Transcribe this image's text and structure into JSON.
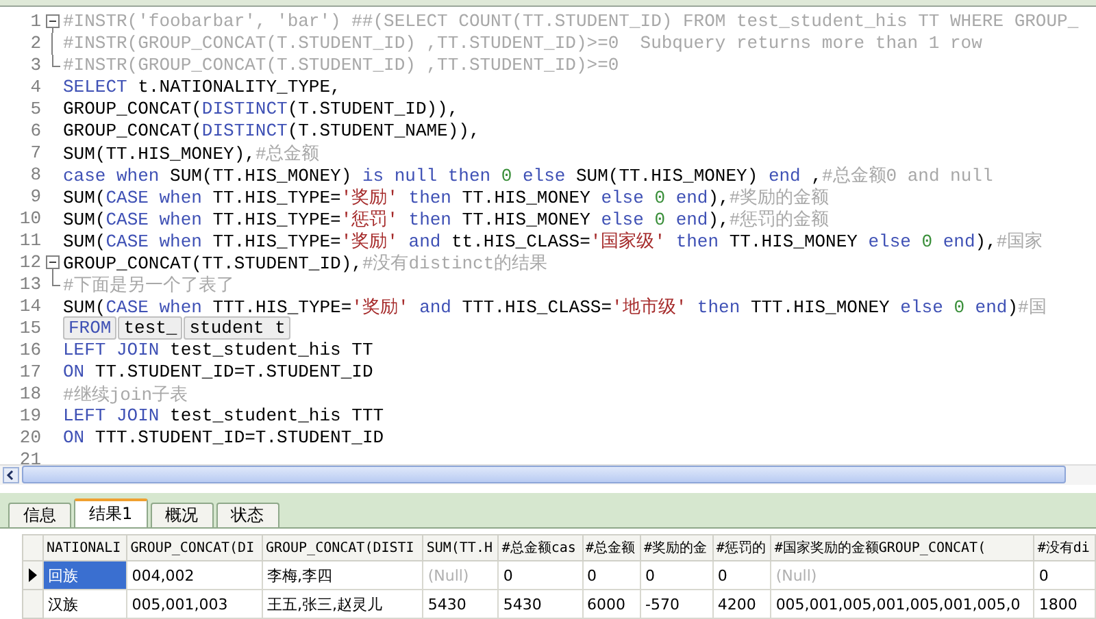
{
  "editor": {
    "lines": [
      {
        "number": "1",
        "kind": "fold-start",
        "tokens": [
          {
            "kind": "comment",
            "text": "#INSTR('foobarbar', 'bar') ##(SELECT COUNT(TT.STUDENT_ID) FROM test_student_his TT WHERE GROUP_"
          }
        ]
      },
      {
        "number": "2",
        "kind": "fold-line",
        "tokens": [
          {
            "kind": "comment",
            "text": "#INSTR(GROUP_CONCAT(T.STUDENT_ID) ,TT.STUDENT_ID)>=0  Subquery returns more than 1 row"
          }
        ]
      },
      {
        "number": "3",
        "kind": "fold-end",
        "tokens": [
          {
            "kind": "comment",
            "text": "#INSTR(GROUP_CONCAT(T.STUDENT_ID) ,TT.STUDENT_ID)>=0"
          }
        ]
      },
      {
        "number": "4",
        "kind": "code",
        "tokens": [
          {
            "kind": "keyword",
            "text": "SELECT"
          },
          {
            "kind": "plain",
            "text": " t.NATIONALITY_TYPE,"
          }
        ]
      },
      {
        "number": "5",
        "kind": "code",
        "tokens": [
          {
            "kind": "plain",
            "text": "GROUP_CONCAT("
          },
          {
            "kind": "keyword",
            "text": "DISTINCT"
          },
          {
            "kind": "plain",
            "text": "(T.STUDENT_ID)),"
          }
        ]
      },
      {
        "number": "6",
        "kind": "code",
        "tokens": [
          {
            "kind": "plain",
            "text": "GROUP_CONCAT("
          },
          {
            "kind": "keyword",
            "text": "DISTINCT"
          },
          {
            "kind": "plain",
            "text": "(T.STUDENT_NAME)),"
          }
        ]
      },
      {
        "number": "7",
        "kind": "code",
        "tokens": [
          {
            "kind": "plain",
            "text": "SUM(TT.HIS_MONEY),"
          },
          {
            "kind": "comment",
            "text": "#总金额"
          }
        ]
      },
      {
        "number": "8",
        "kind": "code",
        "tokens": [
          {
            "kind": "keyword",
            "text": "case when"
          },
          {
            "kind": "plain",
            "text": " SUM(TT.HIS_MONEY) "
          },
          {
            "kind": "keyword",
            "text": "is null then"
          },
          {
            "kind": "number",
            "text": " 0"
          },
          {
            "kind": "keyword",
            "text": " else"
          },
          {
            "kind": "plain",
            "text": " SUM(TT.HIS_MONEY) "
          },
          {
            "kind": "keyword",
            "text": "end"
          },
          {
            "kind": "plain",
            "text": " ,"
          },
          {
            "kind": "comment",
            "text": "#总金额0 and null"
          }
        ]
      },
      {
        "number": "9",
        "kind": "code",
        "tokens": [
          {
            "kind": "plain",
            "text": "SUM("
          },
          {
            "kind": "keyword",
            "text": "CASE when"
          },
          {
            "kind": "plain",
            "text": " TT.HIS_TYPE="
          },
          {
            "kind": "string",
            "text": "'奖励'"
          },
          {
            "kind": "keyword",
            "text": " then"
          },
          {
            "kind": "plain",
            "text": " TT.HIS_MONEY "
          },
          {
            "kind": "keyword",
            "text": "else"
          },
          {
            "kind": "number",
            "text": " 0"
          },
          {
            "kind": "keyword",
            "text": " end"
          },
          {
            "kind": "plain",
            "text": "),"
          },
          {
            "kind": "comment",
            "text": "#奖励的金额"
          }
        ]
      },
      {
        "number": "10",
        "kind": "code",
        "tokens": [
          {
            "kind": "plain",
            "text": "SUM("
          },
          {
            "kind": "keyword",
            "text": "CASE when"
          },
          {
            "kind": "plain",
            "text": " TT.HIS_TYPE="
          },
          {
            "kind": "string",
            "text": "'惩罚'"
          },
          {
            "kind": "keyword",
            "text": " then"
          },
          {
            "kind": "plain",
            "text": " TT.HIS_MONEY "
          },
          {
            "kind": "keyword",
            "text": "else"
          },
          {
            "kind": "number",
            "text": " 0"
          },
          {
            "kind": "keyword",
            "text": " end"
          },
          {
            "kind": "plain",
            "text": "),"
          },
          {
            "kind": "comment",
            "text": "#惩罚的金额"
          }
        ]
      },
      {
        "number": "11",
        "kind": "code",
        "tokens": [
          {
            "kind": "plain",
            "text": "SUM("
          },
          {
            "kind": "keyword",
            "text": "CASE when"
          },
          {
            "kind": "plain",
            "text": " TT.HIS_TYPE="
          },
          {
            "kind": "string",
            "text": "'奖励'"
          },
          {
            "kind": "keyword",
            "text": " and"
          },
          {
            "kind": "plain",
            "text": " tt.HIS_CLASS="
          },
          {
            "kind": "string",
            "text": "'国家级'"
          },
          {
            "kind": "keyword",
            "text": " then"
          },
          {
            "kind": "plain",
            "text": " TT.HIS_MONEY "
          },
          {
            "kind": "keyword",
            "text": "else"
          },
          {
            "kind": "number",
            "text": " 0"
          },
          {
            "kind": "keyword",
            "text": " end"
          },
          {
            "kind": "plain",
            "text": "),"
          },
          {
            "kind": "comment",
            "text": "#国家"
          }
        ]
      },
      {
        "number": "12",
        "kind": "fold-start",
        "tokens": [
          {
            "kind": "plain",
            "text": "GROUP_CONCAT(TT.STUDENT_ID),"
          },
          {
            "kind": "comment",
            "text": "#没有distinct的结果"
          }
        ]
      },
      {
        "number": "13",
        "kind": "fold-end",
        "tokens": [
          {
            "kind": "comment",
            "text": "#下面是另一个了表了"
          }
        ]
      },
      {
        "number": "14",
        "kind": "code",
        "tokens": [
          {
            "kind": "plain",
            "text": "SUM("
          },
          {
            "kind": "keyword",
            "text": "CASE when"
          },
          {
            "kind": "plain",
            "text": " TTT.HIS_TYPE="
          },
          {
            "kind": "string",
            "text": "'奖励'"
          },
          {
            "kind": "keyword",
            "text": " and"
          },
          {
            "kind": "plain",
            "text": " TTT.HIS_CLASS="
          },
          {
            "kind": "string",
            "text": "'地市级'"
          },
          {
            "kind": "keyword",
            "text": " then"
          },
          {
            "kind": "plain",
            "text": " TTT.HIS_MONEY "
          },
          {
            "kind": "keyword",
            "text": "else"
          },
          {
            "kind": "number",
            "text": " 0"
          },
          {
            "kind": "keyword",
            "text": " end"
          },
          {
            "kind": "plain",
            "text": ")"
          },
          {
            "kind": "comment",
            "text": "#国"
          }
        ]
      },
      {
        "number": "15",
        "kind": "code",
        "tokens": [
          {
            "kind": "boxed-keyword",
            "text": "FROM"
          },
          {
            "kind": "boxed",
            "text": "test_"
          },
          {
            "kind": "boxed",
            "text": "student t"
          }
        ]
      },
      {
        "number": "16",
        "kind": "code",
        "tokens": [
          {
            "kind": "keyword",
            "text": "LEFT JOIN"
          },
          {
            "kind": "plain",
            "text": " test_student_his TT"
          }
        ]
      },
      {
        "number": "17",
        "kind": "code",
        "tokens": [
          {
            "kind": "keyword",
            "text": "ON"
          },
          {
            "kind": "plain",
            "text": " TT.STUDENT_ID=T.STUDENT_ID"
          }
        ]
      },
      {
        "number": "18",
        "kind": "code",
        "tokens": [
          {
            "kind": "comment",
            "text": "#继续join子表"
          }
        ]
      },
      {
        "number": "19",
        "kind": "code",
        "tokens": [
          {
            "kind": "keyword",
            "text": "LEFT JOIN"
          },
          {
            "kind": "plain",
            "text": " test_student_his TTT"
          }
        ]
      },
      {
        "number": "20",
        "kind": "code",
        "tokens": [
          {
            "kind": "keyword",
            "text": "ON"
          },
          {
            "kind": "plain",
            "text": " TTT.STUDENT_ID=T.STUDENT_ID"
          }
        ]
      },
      {
        "number": "21",
        "kind": "code"
      }
    ]
  },
  "result_tabs": [
    {
      "label": "信息",
      "selected": false
    },
    {
      "label": "结果1",
      "selected": true
    },
    {
      "label": "概况",
      "selected": false
    },
    {
      "label": "状态",
      "selected": false
    }
  ],
  "grid": {
    "columns": [
      "NATIONALI",
      "GROUP_CONCAT(DI",
      "GROUP_CONCAT(DISTI",
      "SUM(TT.H",
      "#总金额cas",
      "#总金额",
      "#奖励的金",
      "#惩罚的",
      "#国家奖励的金额GROUP_CONCAT(",
      "#没有di"
    ],
    "rows": [
      {
        "current": true,
        "cells": [
          {
            "kind": "value",
            "text": "回族",
            "selected": true
          },
          {
            "kind": "value",
            "text": "004,002",
            "selected": false
          },
          {
            "kind": "value",
            "text": "李梅,李四",
            "selected": false
          },
          {
            "kind": "null",
            "text": "(Null)",
            "selected": false
          },
          {
            "kind": "value",
            "text": "0",
            "selected": false
          },
          {
            "kind": "value",
            "text": "0",
            "selected": false
          },
          {
            "kind": "value",
            "text": "0",
            "selected": false
          },
          {
            "kind": "value",
            "text": "0",
            "selected": false
          },
          {
            "kind": "null",
            "text": "(Null)",
            "selected": false
          },
          {
            "kind": "value",
            "text": "0",
            "selected": false
          }
        ]
      },
      {
        "current": false,
        "cells": [
          {
            "kind": "value",
            "text": "汉族",
            "selected": false
          },
          {
            "kind": "value",
            "text": "005,001,003",
            "selected": false
          },
          {
            "kind": "value",
            "text": "王五,张三,赵灵儿",
            "selected": false
          },
          {
            "kind": "value",
            "text": "5430",
            "selected": false
          },
          {
            "kind": "value",
            "text": "5430",
            "selected": false
          },
          {
            "kind": "value",
            "text": "6000",
            "selected": false
          },
          {
            "kind": "value",
            "text": "-570",
            "selected": false
          },
          {
            "kind": "value",
            "text": "4200",
            "selected": false
          },
          {
            "kind": "value",
            "text": "005,001,005,001,005,001,005,0",
            "selected": false
          },
          {
            "kind": "value",
            "text": "1800",
            "selected": false
          }
        ]
      }
    ]
  }
}
